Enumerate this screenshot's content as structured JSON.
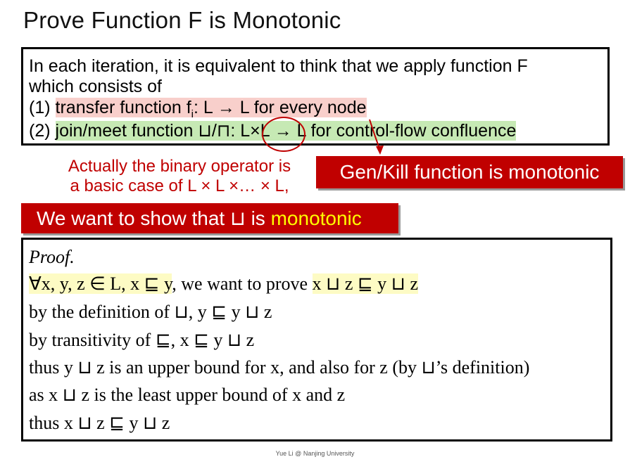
{
  "slide": {
    "title": "Prove Function F is Monotonic",
    "definition": {
      "line1": "In each iteration, it is equivalent to think that we apply function F",
      "line2": "which consists of",
      "item1_num": "(1)",
      "item1_text": "transfer function f",
      "item1_sub": "i",
      "item1_rest": ": L → L for every node",
      "item2_num": "(2)",
      "item2_a": "join/meet function ⊔/⊓: ",
      "item2_b": "L×L",
      "item2_c": " → L for control-flow confluence"
    },
    "red_note": {
      "line1": "Actually the binary operator is",
      "line2": "a basic case of L × L ×… × L,"
    },
    "genkill_label": "Gen/Kill function is monotonic",
    "want": {
      "prefix": "We want to show that ⊔ is ",
      "accent": "monotonic"
    },
    "proof": {
      "heading": "Proof.",
      "l1_a": "∀x, y, z ∈ L, x ⊑ y",
      "l1_b": ", we want to prove ",
      "l1_c": "x ⊔ z ⊑ y ⊔ z",
      "l2": "by the definition of ⊔, y ⊑ y ⊔ z",
      "l3": "by transitivity of ⊑, x ⊑ y ⊔ z",
      "l4": "thus y ⊔ z is an upper bound for x, and also for z (by ⊔’s definition)",
      "l5": "as x ⊔ z is the least upper bound of x and z",
      "l6": "thus x ⊔ z ⊑ y ⊔ z"
    },
    "footer": "Yue Li @ Nanjing University",
    "colors": {
      "accent_red": "#c00000",
      "highlight_red": "#f8cfcb",
      "highlight_green": "#c6e9b4",
      "highlight_yellow": "#fdfbc4",
      "monotonic_yellow": "#ffff00"
    }
  }
}
